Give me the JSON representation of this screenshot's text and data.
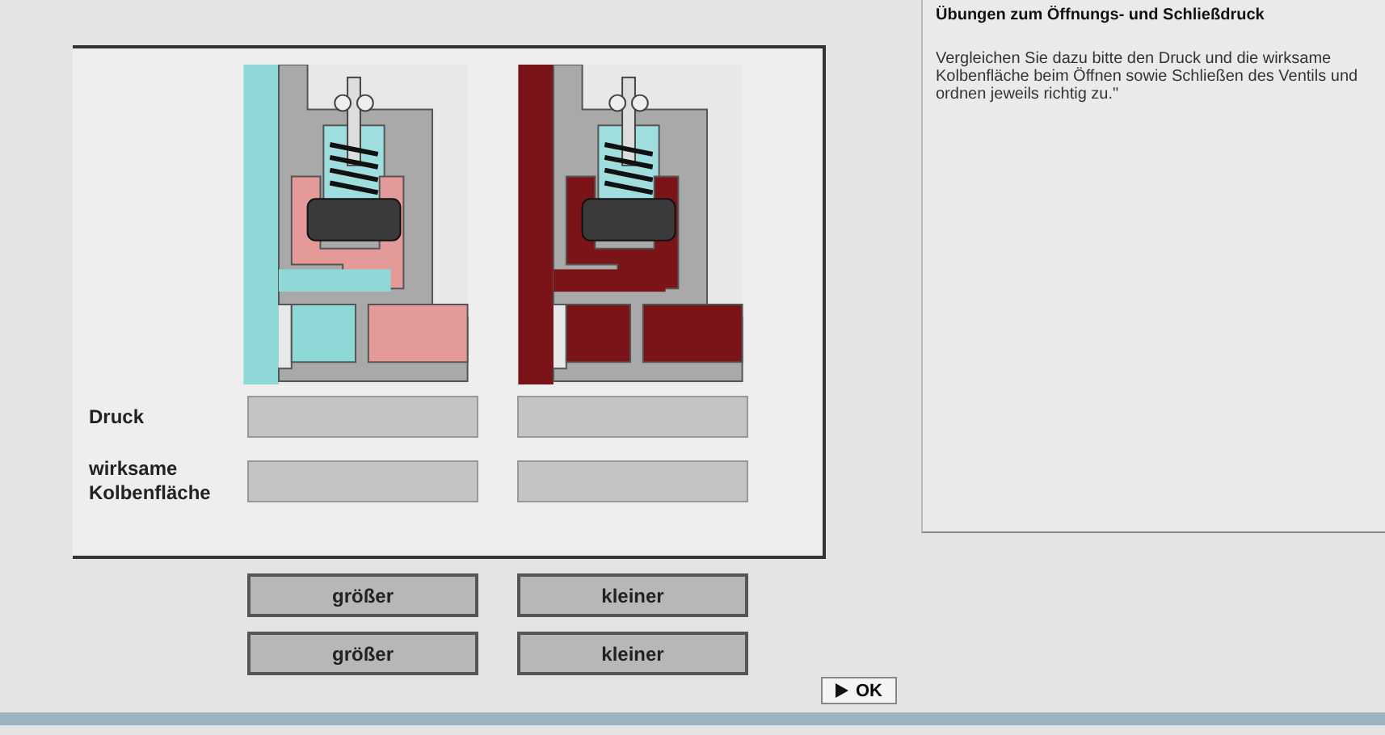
{
  "exercise": {
    "rows": [
      {
        "label": "Druck"
      },
      {
        "label": "wirksame Kolbenfläche"
      }
    ],
    "answers": [
      [
        "größer",
        "kleiner"
      ],
      [
        "größer",
        "kleiner"
      ]
    ],
    "ok_button": {
      "label": "OK"
    }
  },
  "info": {
    "title": "Übungen zum Öffnungs- und Schließdruck",
    "text": "Vergleichen Sie dazu bitte den Druck und die wirksame Kolbenfläche beim Öffnen sowie Schließen des Ventils und ordnen jeweils richtig zu.\""
  }
}
